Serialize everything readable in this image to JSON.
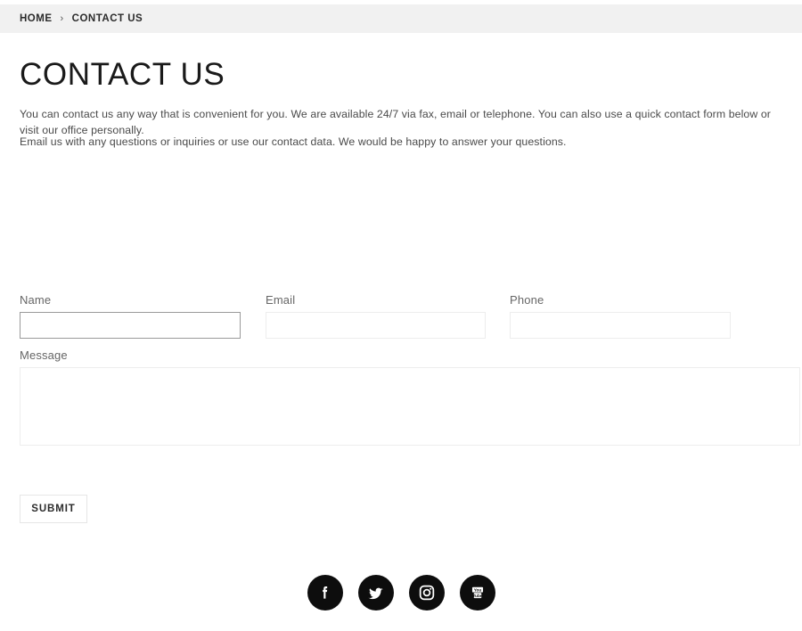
{
  "breadcrumb": {
    "home_label": "HOME",
    "separator": "›",
    "current_label": "CONTACT US"
  },
  "page": {
    "title": "CONTACT US",
    "paragraph_1": "You can contact us any way that is convenient for you. We are available 24/7 via fax, email or telephone. You can also use a quick contact form below or visit our office personally.",
    "paragraph_2": "Email us with any questions or inquiries or use our contact data. We would be happy to answer your questions."
  },
  "form": {
    "name": {
      "label": "Name",
      "value": "",
      "placeholder": ""
    },
    "email": {
      "label": "Email",
      "value": "",
      "placeholder": ""
    },
    "phone": {
      "label": "Phone",
      "value": "",
      "placeholder": ""
    },
    "message": {
      "label": "Message",
      "value": "",
      "placeholder": ""
    },
    "submit_label": "SUBMIT"
  },
  "social": {
    "items": [
      {
        "name": "facebook-icon",
        "label": "Facebook"
      },
      {
        "name": "twitter-icon",
        "label": "Twitter"
      },
      {
        "name": "instagram-icon",
        "label": "Instagram"
      },
      {
        "name": "youtube-icon",
        "label": "YouTube"
      }
    ]
  },
  "colors": {
    "breadcrumb_bar_background": "#f1f1f1",
    "page_background": "#ffffff",
    "text_primary": "#1a1a1a",
    "text_body": "#4a4a4a",
    "label": "#666666",
    "input_border": "#ededed",
    "input_border_focused": "#9a9a9a",
    "social_icon_background": "#0d0d0d"
  }
}
